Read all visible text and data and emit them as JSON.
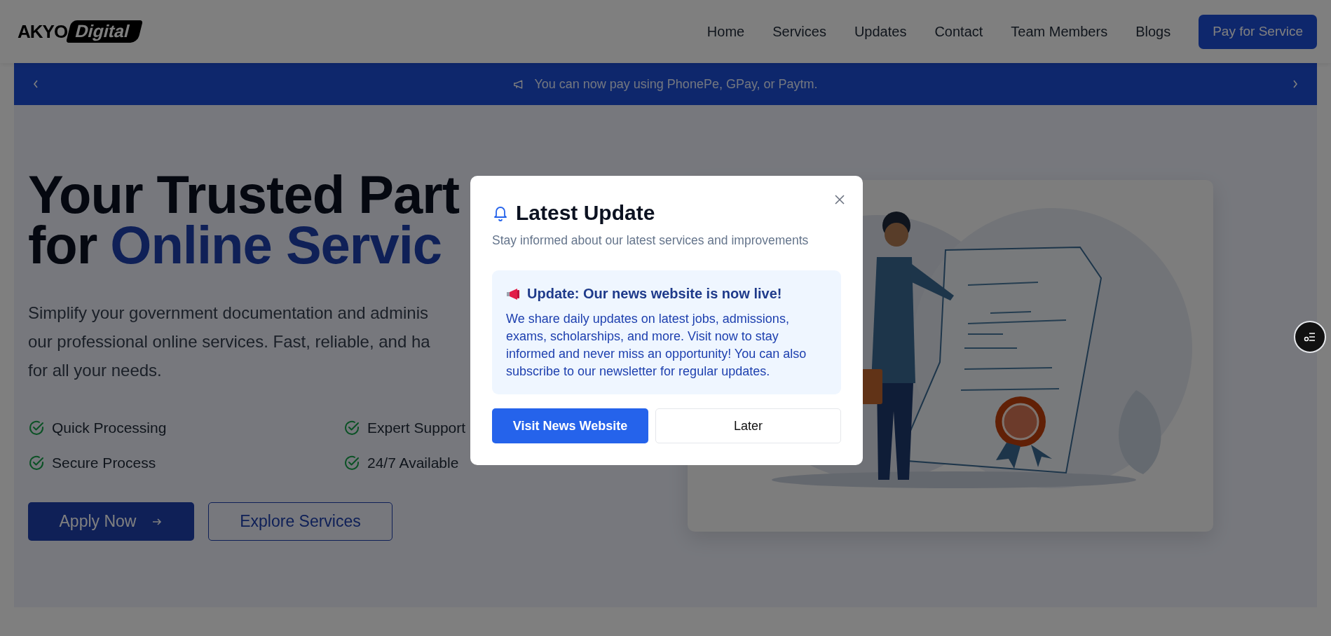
{
  "header": {
    "logo": {
      "text": "AKYO",
      "badge": "Digital"
    },
    "nav": [
      {
        "label": "Home"
      },
      {
        "label": "Services"
      },
      {
        "label": "Updates"
      },
      {
        "label": "Contact"
      },
      {
        "label": "Team Members"
      },
      {
        "label": "Blogs"
      }
    ],
    "cta": "Pay for Service"
  },
  "announcement": {
    "text": "You can now pay using PhonePe, GPay, or Paytm."
  },
  "hero": {
    "title": {
      "line_1": "Your Trusted Part",
      "line_2_prefix": "for",
      "line_2_highlight": "Online Servic"
    },
    "description_lines": [
      "Simplify your government documentation and adminis",
      "our professional online services. Fast, reliable, and ha",
      "for all your needs."
    ],
    "features": [
      {
        "label": "Quick Processing"
      },
      {
        "label": "Expert Support"
      },
      {
        "label": "Secure Process"
      },
      {
        "label": "24/7 Available"
      }
    ],
    "buttons": [
      {
        "label": "Apply Now",
        "kind": "primary"
      },
      {
        "label": "Explore Services",
        "kind": "outline"
      }
    ],
    "illustration": {
      "kind": "picture"
    }
  },
  "modal": {
    "title": "Latest Update",
    "subtitle": "Stay informed about our latest services and improvements",
    "notice": {
      "heading": "Update: Our news website is now live!",
      "body": "We share daily updates on latest jobs, admissions, exams, scholarships, and more. Visit now to stay informed and never miss an opportunity! You can also subscribe to our newsletter for regular updates."
    },
    "buttons": [
      {
        "label": "Visit News Website",
        "kind": "primary"
      },
      {
        "label": "Later",
        "kind": "outline"
      }
    ]
  }
}
